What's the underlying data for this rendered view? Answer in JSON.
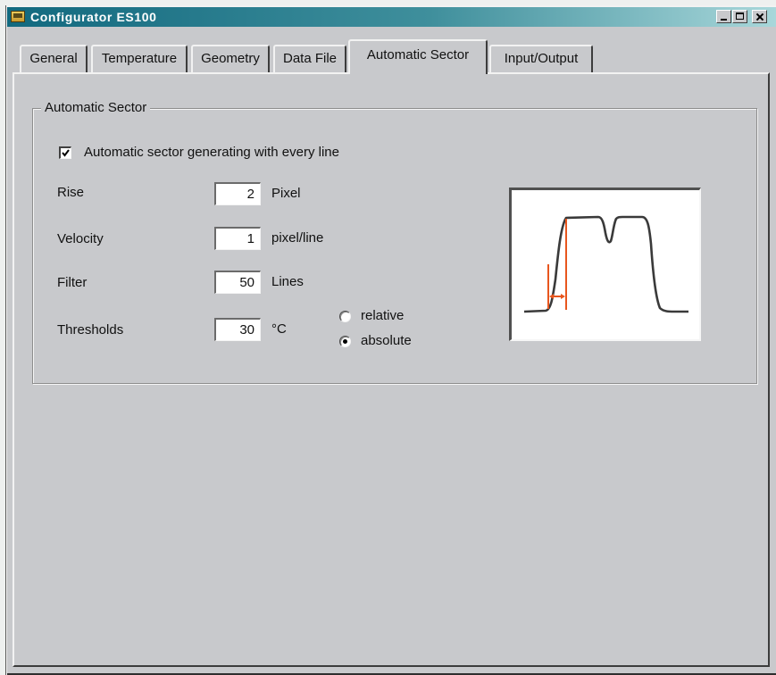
{
  "window": {
    "title": "Configurator ES100",
    "app_icon": "app-icon",
    "controls": [
      {
        "name": "minimize",
        "icon": "minimize-icon"
      },
      {
        "name": "maximize",
        "icon": "maximize-icon"
      },
      {
        "name": "close",
        "icon": "close-icon"
      }
    ]
  },
  "tabs": [
    {
      "label": "General",
      "active": false
    },
    {
      "label": "Temperature",
      "active": false
    },
    {
      "label": "Geometry",
      "active": false
    },
    {
      "label": "Data File",
      "active": false
    },
    {
      "label": "Automatic Sector",
      "active": true
    },
    {
      "label": "Input/Output",
      "active": false
    }
  ],
  "automatic_sector": {
    "group_label": "Automatic Sector",
    "auto_generate": {
      "label": "Automatic sector generating with every line",
      "checked": true
    },
    "rise": {
      "label": "Rise",
      "value": "2",
      "unit": "Pixel"
    },
    "velocity": {
      "label": "Velocity",
      "value": "1",
      "unit": "pixel/line"
    },
    "filter": {
      "label": "Filter",
      "value": "50",
      "unit": "Lines"
    },
    "thresholds": {
      "label": "Thresholds",
      "value": "30",
      "unit": "°C"
    },
    "threshold_mode": [
      {
        "label": "relative",
        "selected": false
      },
      {
        "label": "absolute",
        "selected": true
      }
    ]
  },
  "preview": {
    "icon": "sector-profile-illustration"
  },
  "colors": {
    "dialog_background": "#c8c9cc",
    "title_bar_start": "#12697f",
    "title_bar_end": "#a8d7da",
    "curve": "#3a3a3a",
    "marker": "#e8561e"
  }
}
